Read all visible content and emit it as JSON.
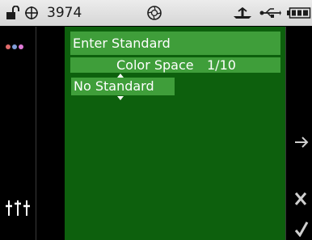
{
  "status_bar": {
    "lock_icon": "unlock-icon",
    "target_icon": "crosshair-icon",
    "counter": "3974",
    "aperture_icon": "aperture-icon",
    "antenna_icon": "antenna-icon",
    "usb_icon": "usb-icon",
    "battery_icon": "battery-icon"
  },
  "left_panel": {
    "color_dots": [
      "#e06a6a",
      "#7f9dd8",
      "#e07ad8"
    ],
    "settings_icon": "sliders-icon"
  },
  "menu": {
    "title": "Enter Standard",
    "option_label": "Color Space",
    "option_counter": "1/10",
    "option_value": "No Standard"
  },
  "right_panel": {
    "next_icon": "arrow-right-icon",
    "cancel_icon": "x-icon",
    "confirm_icon": "checkmark-icon"
  }
}
